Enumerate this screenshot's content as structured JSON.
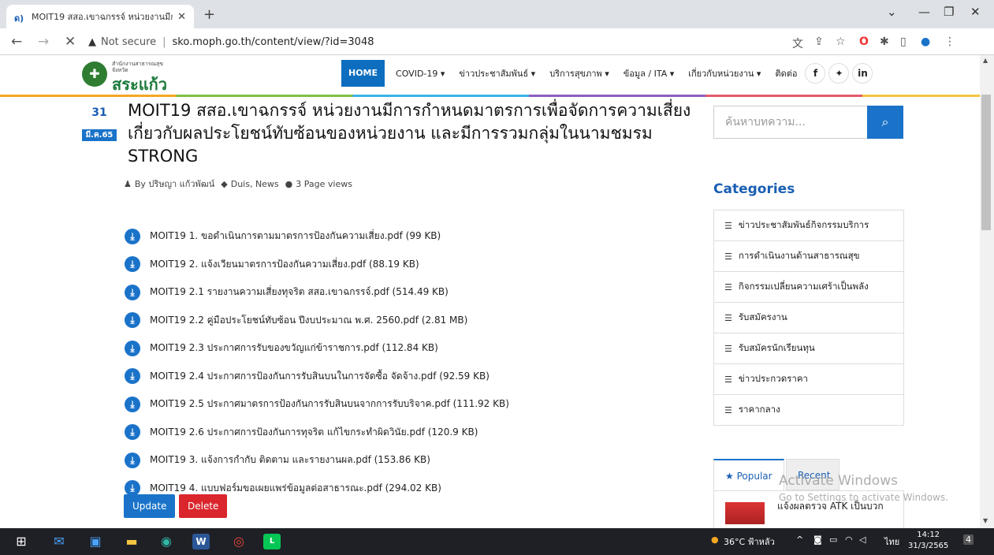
{
  "browser": {
    "tab_title": "MOIT19 สสอ.เขาฉกรรจ์ หน่วยงานมีก",
    "tab_favicon": "ด)",
    "new_tab": "+",
    "close_tab": "✕",
    "win_min": "—",
    "win_restore": "❐",
    "win_close": "✕",
    "win_chevron": "⌄",
    "not_secure": "Not secure",
    "url": "sko.moph.go.th/content/view/?id=3048",
    "back": "←",
    "forward": "→",
    "stop": "✕"
  },
  "site": {
    "logo_small_line1": "สำนักงานสาธารณสุข",
    "logo_small_line2": "จังหวัด",
    "logo_big": "สระแก้ว",
    "nav": {
      "home": "HOME",
      "items": [
        "COVID-19 ▾",
        "ข่าวประชาสัมพันธ์ ▾",
        "บริการสุขภาพ ▾",
        "ข้อมูล / ITA ▾",
        "เกี่ยวกับหน่วยงาน ▾",
        "ติดต่อ"
      ]
    },
    "social": [
      "f",
      "🐦",
      "in"
    ]
  },
  "article": {
    "day": "31",
    "month": "มี.ค.65",
    "title": "MOIT19 สสอ.เขาฉกรรจ์ หน่วยงานมีการกำหนดมาตรการเพื่อจัดการความเสี่ยงเกี่ยวกับผลประโยชน์ทับซ้อนของหน่วยงาน และมีการรวมกลุ่มในนามชมรม STRONG",
    "author": "By ปริษญา แก้วพัฒน์",
    "tags": "Duis, News",
    "views": "3 Page views",
    "files": [
      "MOIT19 1. ขอดำเนินการตามมาตรการป้องกันความเสี่ยง.pdf (99 KB)",
      "MOIT19 2. แจ้งเวียนมาตรการป้องกันความเสี่ยง.pdf (88.19 KB)",
      "MOIT19 2.1 รายงานความเสี่ยงทุจริต สสอ.เขาฉกรรจ์.pdf (514.49 KB)",
      "MOIT19 2.2 คู่มือประโยชน์ทับซ้อน ปีงบประมาณ พ.ศ. 2560.pdf (2.81 MB)",
      "MOIT19 2.3 ประกาศการรับของขวัญแก่ข้าราชการ.pdf (112.84 KB)",
      "MOIT19 2.4 ประกาศการป้องกันการรับสินบนในการจัดซื้อ จัดจ้าง.pdf (92.59 KB)",
      "MOIT19 2.5 ประกาศมาตรการป้องกันการรับสินบนจากการรับบริจาค.pdf (111.92 KB)",
      "MOIT19 2.6 ประกาศการป้องกันการทุจริต แก้ไขกระทำผิดวินัย.pdf (120.9 KB)",
      "MOIT19 3. แจ้งการกำกับ ติดตาม และรายงานผล.pdf (153.86 KB)",
      "MOIT19 4. แบบฟอร์มขอเผยแพร่ข้อมูลต่อสาธารณะ.pdf (294.02 KB)"
    ],
    "update_label": "Update",
    "delete_label": "Delete"
  },
  "sidebar": {
    "search_placeholder": "ค้นหาบทความ...",
    "categories_heading": "Categories",
    "categories": [
      "ข่าวประชาสัมพันธ์กิจกรรมบริการ",
      "การดำเนินงานด้านสาธารณสุข",
      "กิจกรรมเปลี่ยนความเศร้าเป็นพลัง",
      "รับสมัครงาน",
      "รับสมัครนักเรียนทุน",
      "ข่าวประกวดราคา",
      "ราคากลาง"
    ],
    "tab_popular": "Popular",
    "tab_recent": "Recent",
    "popular_item": "แจ้งผลตรวจ ATK เป็นบวก"
  },
  "windows": {
    "watermark_title": "Activate Windows",
    "watermark_sub": "Go to Settings to activate Windows.",
    "weather": "36°C ฟ้าหลัว",
    "lang": "ไทย",
    "time": "14:12",
    "date": "31/3/2565",
    "notif_count": "4"
  },
  "colors": {
    "accent": "#1a73c9",
    "danger": "#d9252b",
    "brand_green": "#1b7a3a"
  }
}
